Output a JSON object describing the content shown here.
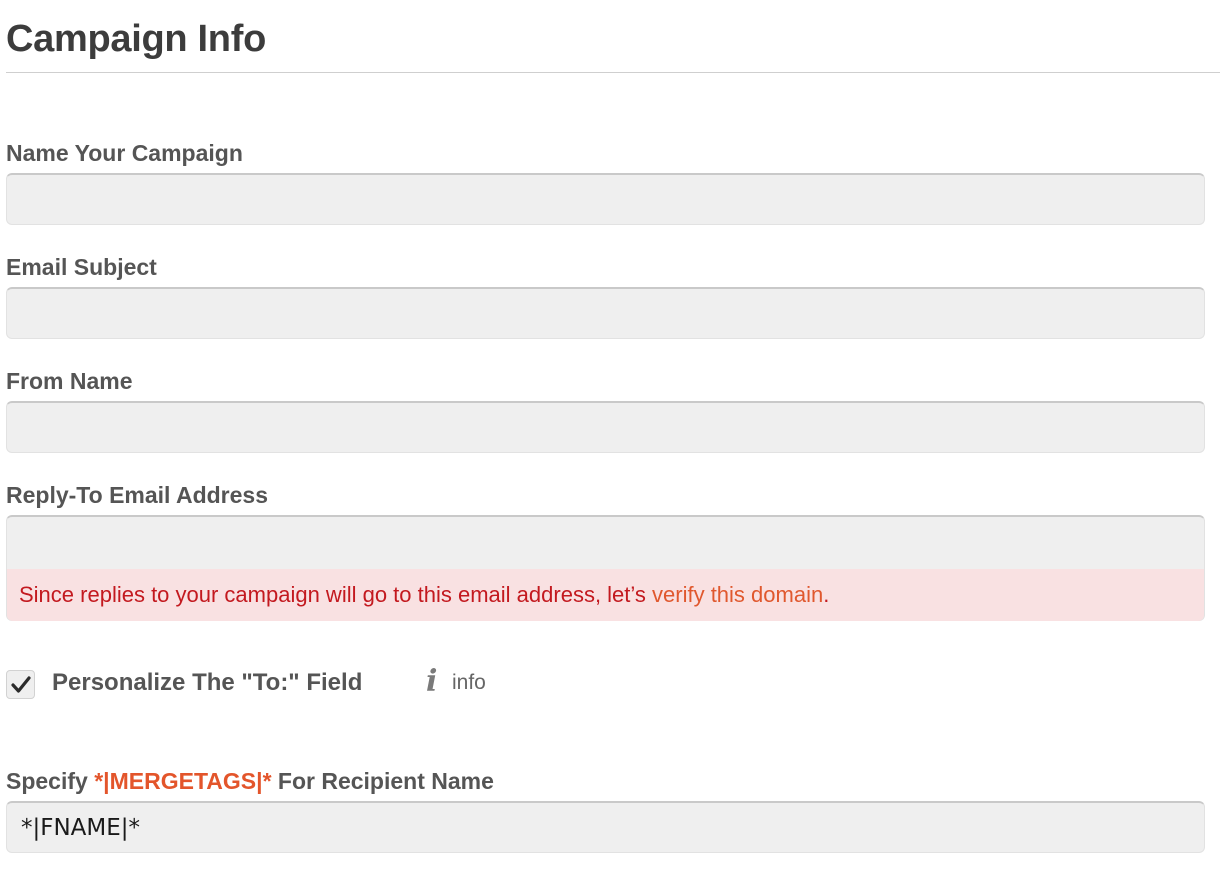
{
  "header": {
    "title": "Campaign Info"
  },
  "fields": {
    "campaign_name": {
      "label": "Name Your Campaign",
      "value": ""
    },
    "email_subject": {
      "label": "Email Subject",
      "value": ""
    },
    "from_name": {
      "label": "From Name",
      "value": ""
    },
    "reply_to": {
      "label": "Reply-To Email Address",
      "value": "",
      "warning_text": "Since replies to your campaign will go to this email address, let’s ",
      "warning_link": "verify this domain",
      "warning_end": "."
    }
  },
  "personalize": {
    "checked": true,
    "label": "Personalize The \"To:\" Field",
    "info_icon": "i",
    "info_label": "info"
  },
  "merge": {
    "label_prefix": "Specify ",
    "label_tag": "*|MERGETAGS|*",
    "label_suffix": " For Recipient Name",
    "value": "*|FNAME|*"
  },
  "colors": {
    "warning_bg": "#f9e1e2",
    "warning_text": "#c3191f",
    "accent": "#e3552b"
  }
}
